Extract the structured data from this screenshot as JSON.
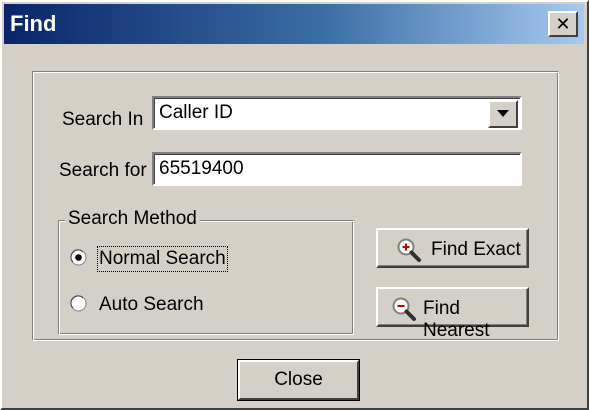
{
  "window": {
    "title": "Find",
    "close_glyph": "✕"
  },
  "form": {
    "search_in_label": "Search In",
    "search_in_value": "Caller ID",
    "search_for_label": "Search for",
    "search_for_value": "65519400"
  },
  "search_method": {
    "legend": "Search Method",
    "options": [
      {
        "label": "Normal Search",
        "selected": true
      },
      {
        "label": "Auto Search",
        "selected": false
      }
    ]
  },
  "buttons": {
    "find_exact": "Find Exact",
    "find_nearest": "Find Nearest",
    "close": "Close"
  },
  "icons": {
    "find_exact": "zoom-in-magnifier-icon",
    "find_nearest": "zoom-out-magnifier-icon",
    "dropdown": "chevron-down-icon"
  },
  "colors": {
    "title_start": "#0a246a",
    "title_end": "#a6caf0",
    "face": "#d4d0c8",
    "magnifier_red": "#cc0000"
  }
}
